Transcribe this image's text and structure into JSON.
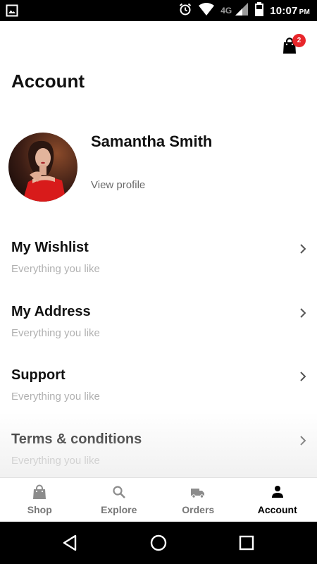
{
  "status_bar": {
    "time": "10:07",
    "ampm": "PM",
    "network": "4G",
    "icons": [
      "image-icon",
      "alarm-icon",
      "wifi-icon",
      "signal-icon",
      "battery-icon"
    ]
  },
  "header": {
    "cart_icon": "shopping-bag-icon",
    "cart_count": "2",
    "title": "Account"
  },
  "profile": {
    "name": "Samantha Smith",
    "link_label": "View profile"
  },
  "menu": [
    {
      "title": "My Wishlist",
      "subtitle": "Everything you like"
    },
    {
      "title": "My Address",
      "subtitle": "Everything you like"
    },
    {
      "title": "Support",
      "subtitle": "Everything you like"
    },
    {
      "title": "Terms & conditions",
      "subtitle": "Everything you like"
    }
  ],
  "bottom_nav": [
    {
      "label": "Shop",
      "icon": "shopping-bag-icon",
      "active": false
    },
    {
      "label": "Explore",
      "icon": "search-icon",
      "active": false
    },
    {
      "label": "Orders",
      "icon": "truck-icon",
      "active": false
    },
    {
      "label": "Account",
      "icon": "person-icon",
      "active": true
    }
  ],
  "colors": {
    "badge": "#e8262b",
    "active": "#000000",
    "inactive": "#777777",
    "subtitle": "#b0b0b0"
  }
}
